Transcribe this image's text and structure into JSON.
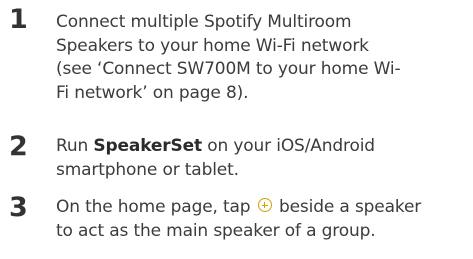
{
  "steps": [
    {
      "number": "1",
      "lines": [
        "Connect multiple Spotify Multiroom",
        "Speakers to your home Wi-Fi network",
        "(see ‘Connect SW700M to your home Wi-",
        "Fi network’ on page 8)."
      ]
    },
    {
      "number": "2",
      "line1_prefix": "Run ",
      "line1_bold": "SpeakerSet",
      "line1_suffix": " on your iOS/Android",
      "line2": "smartphone or tablet."
    },
    {
      "number": "3",
      "line1_prefix": "On the home page, tap",
      "icon": "add-circle-icon",
      "line1_suffix": "beside a speaker",
      "line2": "to act as the main speaker of a group."
    }
  ]
}
